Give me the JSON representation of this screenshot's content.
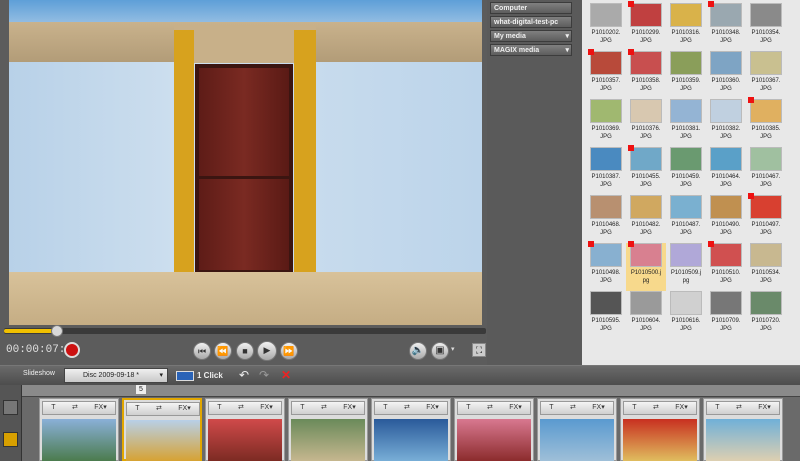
{
  "player": {
    "timecode": "00:00:07:00",
    "position_fraction": 0.11
  },
  "sidebar": {
    "items": [
      {
        "label": "Computer",
        "has_dropdown": false
      },
      {
        "label": "what-digital-test-pc",
        "has_dropdown": false
      },
      {
        "label": "My media",
        "has_dropdown": true
      },
      {
        "label": "MAGIX media",
        "has_dropdown": true
      }
    ]
  },
  "media": {
    "files": [
      {
        "name": "P1010202.",
        "ext": "JPG",
        "flag": false,
        "color": "#aaaaaa"
      },
      {
        "name": "P1010299.",
        "ext": "JPG",
        "flag": true,
        "color": "#c04040"
      },
      {
        "name": "P1010316.",
        "ext": "JPG",
        "flag": false,
        "color": "#d9b24a"
      },
      {
        "name": "P1010348.",
        "ext": "JPG",
        "flag": true,
        "color": "#9aa8b0"
      },
      {
        "name": "P1010354.",
        "ext": "JPG",
        "flag": false,
        "color": "#8a8a8a"
      },
      {
        "name": "P1010357.",
        "ext": "JPG",
        "flag": true,
        "color": "#b84a3a"
      },
      {
        "name": "P1010358.",
        "ext": "JPG",
        "flag": true,
        "color": "#c84f4f"
      },
      {
        "name": "P1010359.",
        "ext": "JPG",
        "flag": false,
        "color": "#8a9e5a"
      },
      {
        "name": "P1010360.",
        "ext": "JPG",
        "flag": false,
        "color": "#7ea4c4"
      },
      {
        "name": "P1010367.",
        "ext": "JPG",
        "flag": false,
        "color": "#c9c090"
      },
      {
        "name": "P1010369.",
        "ext": "JPG",
        "flag": false,
        "color": "#a0b870"
      },
      {
        "name": "P1010376.",
        "ext": "JPG",
        "flag": false,
        "color": "#d8c8b0"
      },
      {
        "name": "P1010381.",
        "ext": "JPG",
        "flag": false,
        "color": "#94b4d4"
      },
      {
        "name": "P1010382.",
        "ext": "JPG",
        "flag": false,
        "color": "#c0d0e0"
      },
      {
        "name": "P1010385.",
        "ext": "JPG",
        "flag": true,
        "color": "#e0b060"
      },
      {
        "name": "P1010387.",
        "ext": "JPG",
        "flag": false,
        "color": "#4a8ac0"
      },
      {
        "name": "P1010455.",
        "ext": "JPG",
        "flag": true,
        "color": "#70a8c8"
      },
      {
        "name": "P1010459.",
        "ext": "JPG",
        "flag": false,
        "color": "#6a9a70"
      },
      {
        "name": "P1010464.",
        "ext": "JPG",
        "flag": false,
        "color": "#5aa0c8"
      },
      {
        "name": "P1010467.",
        "ext": "JPG",
        "flag": false,
        "color": "#a0c0a0"
      },
      {
        "name": "P1010468.",
        "ext": "JPG",
        "flag": false,
        "color": "#b89070"
      },
      {
        "name": "P1010482.",
        "ext": "JPG",
        "flag": false,
        "color": "#d0a860"
      },
      {
        "name": "P1010487.",
        "ext": "JPG",
        "flag": false,
        "color": "#7ab0d0"
      },
      {
        "name": "P1010490.",
        "ext": "JPG",
        "flag": false,
        "color": "#c09050"
      },
      {
        "name": "P1010497.",
        "ext": "JPG",
        "flag": true,
        "color": "#d84030"
      },
      {
        "name": "P1010498.",
        "ext": "JPG",
        "flag": true,
        "color": "#88b0d0"
      },
      {
        "name": "P1010500.j",
        "ext": "pg",
        "flag": true,
        "color": "#d88090",
        "selected": true
      },
      {
        "name": "P1010509.j",
        "ext": "pg",
        "flag": false,
        "color": "#b0a8d8"
      },
      {
        "name": "P1010510.",
        "ext": "JPG",
        "flag": true,
        "color": "#d05050"
      },
      {
        "name": "P1010534.",
        "ext": "JPG",
        "flag": false,
        "color": "#c8b890"
      },
      {
        "name": "P1010595.",
        "ext": "JPG",
        "flag": false,
        "color": "#555555"
      },
      {
        "name": "P1010604.",
        "ext": "JPG",
        "flag": false,
        "color": "#9a9a9a"
      },
      {
        "name": "P1010616.",
        "ext": "JPG",
        "flag": false,
        "color": "#d0d0d0"
      },
      {
        "name": "P1010709.",
        "ext": "JPG",
        "flag": false,
        "color": "#777777"
      },
      {
        "name": "P1010720.",
        "ext": "JPG",
        "flag": false,
        "color": "#6a8a6a"
      }
    ]
  },
  "toolbar": {
    "slideshow_label": "Slideshow",
    "disc_value": "Disc 2009-09-18 *",
    "one_click_label": "1 Click"
  },
  "timeline": {
    "marker_label": "5",
    "slot_controls": [
      "T",
      "⇄",
      "FX▾"
    ],
    "slots": [
      {
        "colors": [
          "#8ab0d8",
          "#4a7a4a"
        ],
        "active": false
      },
      {
        "colors": [
          "#b8d0e8",
          "#d8a02a"
        ],
        "active": true
      },
      {
        "colors": [
          "#d04a4a",
          "#7a2a22"
        ],
        "active": false
      },
      {
        "colors": [
          "#6a8a5a",
          "#c8b890"
        ],
        "active": false
      },
      {
        "colors": [
          "#2a5a9a",
          "#7ab0d8"
        ],
        "active": false
      },
      {
        "colors": [
          "#d87890",
          "#8a2a2a"
        ],
        "active": false
      },
      {
        "colors": [
          "#5a9ad0",
          "#a0c0d8"
        ],
        "active": false
      },
      {
        "colors": [
          "#c83020",
          "#e0c060"
        ],
        "active": false
      },
      {
        "colors": [
          "#70b0d8",
          "#e0d0b0"
        ],
        "active": false
      }
    ]
  },
  "colors": {
    "accent": "#f0c000",
    "record": "#cc1111",
    "delete": "#e22222"
  }
}
